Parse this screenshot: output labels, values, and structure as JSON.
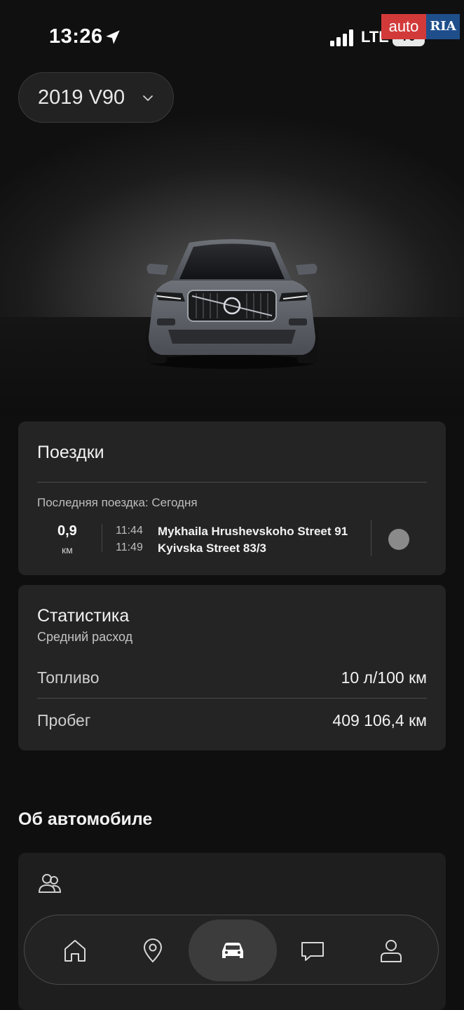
{
  "status_bar": {
    "time": "13:26",
    "network": "LTE",
    "battery": "70"
  },
  "watermark": {
    "left_text": "auto",
    "right_text": "RIA"
  },
  "car_selector": {
    "label": "2019 V90"
  },
  "trips": {
    "title": "Поездки",
    "last_trip_label": "Последняя поездка: Сегодня",
    "distance": "0,9",
    "distance_unit": "км",
    "start_time": "11:44",
    "start_address": "Mykhaila Hrushevskoho Street 91",
    "end_time": "11:49",
    "end_address": "Kyivska Street 83/3"
  },
  "stats": {
    "title": "Статистика",
    "subtitle": "Средний расход",
    "rows": [
      {
        "label": "Топливо",
        "value": "10 л/100 км"
      },
      {
        "label": "Пробег",
        "value": "409 106,4 км"
      }
    ]
  },
  "about": {
    "title": "Об автомобиле"
  },
  "nav": {
    "items": [
      "home-icon",
      "map-pin-icon",
      "car-icon",
      "chat-icon",
      "profile-icon"
    ],
    "active": "car-icon"
  },
  "colors": {
    "background": "#0f0f0f",
    "card": "#242424",
    "divider": "#4a4a4a"
  }
}
